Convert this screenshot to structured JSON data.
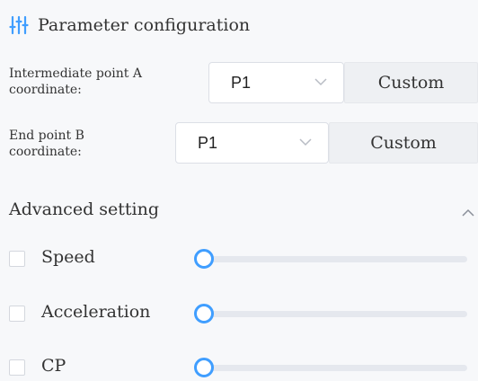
{
  "header": {
    "title": "Parameter configuration",
    "icon": "sliders-icon",
    "accent": "#409eff"
  },
  "point_a": {
    "label_line1": "Intermediate point A",
    "label_line2": "coordinate:",
    "selected": "P1",
    "custom_label": "Custom"
  },
  "point_b": {
    "label_line1": "End point B",
    "label_line2": "coordinate:",
    "selected": "P1",
    "custom_label": "Custom"
  },
  "advanced": {
    "title": "Advanced setting",
    "expanded": true,
    "params": [
      {
        "label": "Speed",
        "checked": false,
        "level": 0
      },
      {
        "label": "Acceleration",
        "checked": false,
        "level": 0
      },
      {
        "label": "CP",
        "checked": false,
        "level": 0
      }
    ]
  }
}
